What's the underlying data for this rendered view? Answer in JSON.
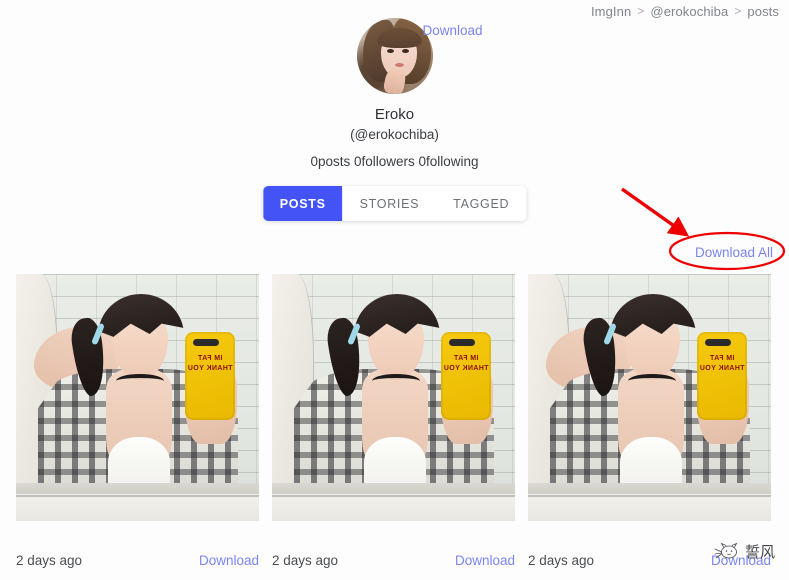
{
  "breadcrumb": {
    "items": [
      "ImgInn",
      "@erokochiba",
      "posts"
    ],
    "separator": ">"
  },
  "profile": {
    "avatar_alt": "profile-photo",
    "download_label": "Download",
    "display_name": "Eroko",
    "handle": "(@erokochiba)",
    "stats": "0posts 0followers 0following"
  },
  "tabs": [
    {
      "label": "POSTS",
      "active": true
    },
    {
      "label": "STORIES",
      "active": false
    },
    {
      "label": "TAGGED",
      "active": false
    }
  ],
  "actions": {
    "download_all_label": "Download All"
  },
  "annotation": {
    "color": "#ee0000",
    "shape": "ellipse-and-arrow",
    "target": "Download All"
  },
  "posts": [
    {
      "time": "2 days ago",
      "download_label": "Download",
      "phone_text": "IM FAT THANK YOU"
    },
    {
      "time": "2 days ago",
      "download_label": "Download",
      "phone_text": "IM FAT THANK YOU"
    },
    {
      "time": "2 days ago",
      "download_label": "Download",
      "phone_text": "IM FAT THANK YOU"
    }
  ],
  "watermark": {
    "text": "誓风",
    "icon": "cat-logo-icon"
  },
  "colors": {
    "accent": "#4353f5",
    "link": "#7b84f0",
    "annotation": "#ee0000",
    "text": "#3a3d42",
    "muted": "#8a8f98"
  }
}
